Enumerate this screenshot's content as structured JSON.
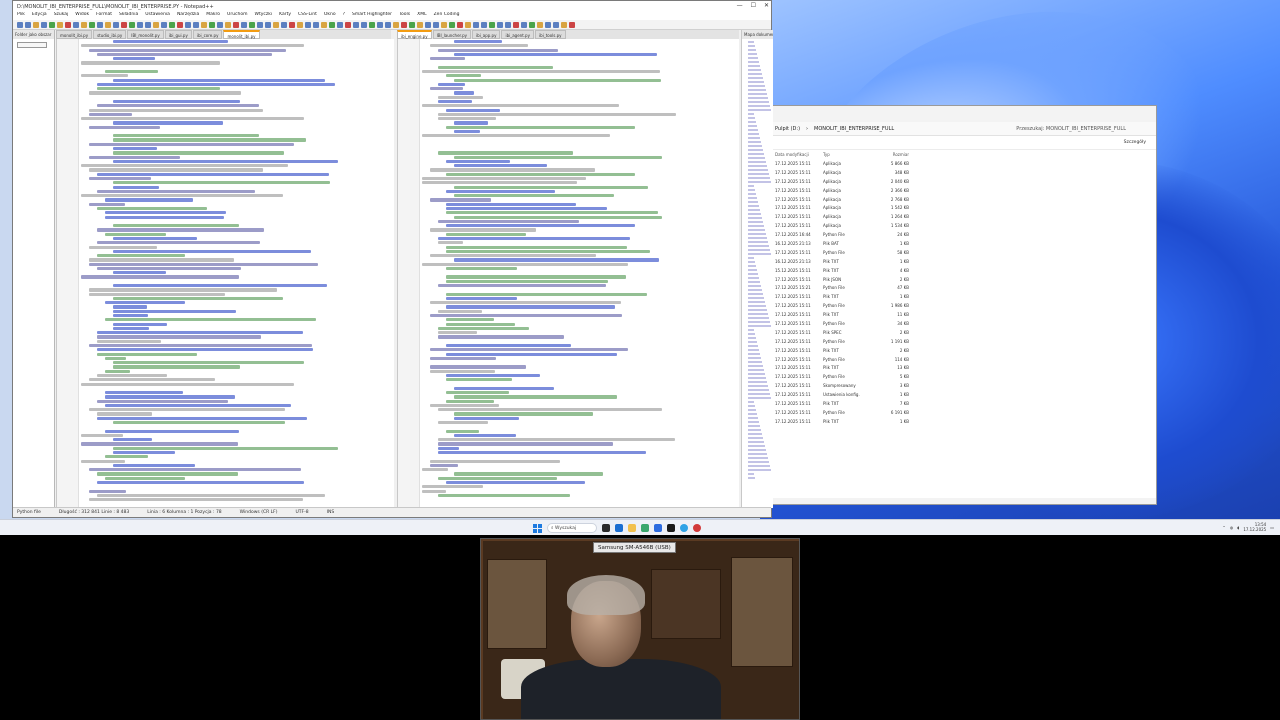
{
  "notepad": {
    "title": "D:\\MONOLIT_IBI_ENTERPRISE_FULL\\MONOLIT_IBI_ENTERPRISE.PY - Notepad++",
    "window_controls": [
      "—",
      "☐",
      "✕"
    ],
    "menu": [
      "Plik",
      "Edycja",
      "Szukaj",
      "Widok",
      "Format",
      "Składnia",
      "Ustawienia",
      "Narzędzia",
      "Makro",
      "Uruchom",
      "Wtyczki",
      "Karty",
      "CSS-Lint",
      "Okno",
      "?",
      "Smart Highlighter",
      "Tools",
      "XML",
      "Zen Coding"
    ],
    "left_tabs": [
      "monolit_ibi.py",
      "studio_ibi.py",
      "IBI_monolit.py",
      "ibi_gui.py",
      "ibi_core.py",
      "monolit_ibi.py"
    ],
    "right_tabs": [
      "ibi_engine.py",
      "IBI_launcher.py",
      "ibi_app.py",
      "ibi_agent.py",
      "ibi_tools.py"
    ],
    "project_panel_title": "Folder jako obszar",
    "docmap_title": "Mapa dokumentu",
    "status": {
      "lang": "Python file",
      "length": "Długość : 312 841   Linie : 8 483",
      "pos": "Linia : 6   Kolumna : 1   Pozycja : 78",
      "eol": "Windows (CR LF)",
      "enc": "UTF-8",
      "mode": "INS"
    }
  },
  "explorer": {
    "breadcrumb": [
      "Pulpit (D:)",
      "MONOLIT_IBI_ENTERPRISE_FULL"
    ],
    "search_placeholder": "Przeszukaj: MONOLIT_IBI_ENTERPRISE_FULL",
    "details_button": "Szczegóły",
    "headers": [
      "Data modyfikacji",
      "Typ",
      "Rozmiar"
    ],
    "rows": [
      [
        "17.12.2025 15:11",
        "Aplikacja",
        "5 866 KB"
      ],
      [
        "17.12.2025 15:11",
        "Aplikacja",
        "348 KB"
      ],
      [
        "17.12.2025 15:11",
        "Aplikacja",
        "2 040 KB"
      ],
      [
        "17.12.2025 15:11",
        "Aplikacja",
        "2 366 KB"
      ],
      [
        "17.12.2025 15:11",
        "Aplikacja",
        "2 768 KB"
      ],
      [
        "17.12.2025 15:11",
        "Aplikacja",
        "1 542 KB"
      ],
      [
        "17.12.2025 15:11",
        "Aplikacja",
        "1 264 KB"
      ],
      [
        "17.12.2025 15:11",
        "Aplikacja",
        "1 534 KB"
      ],
      [
        "17.12.2025 16:44",
        "Python File",
        "24 KB"
      ],
      [
        "16.12.2025 21:13",
        "Plik BAT",
        "1 KB"
      ],
      [
        "17.12.2025 15:11",
        "Python File",
        "58 KB"
      ],
      [
        "16.12.2025 21:13",
        "Plik TXT",
        "1 KB"
      ],
      [
        "15.12.2025 15:11",
        "Plik TXT",
        "4 KB"
      ],
      [
        "17.12.2025 15:11",
        "Plik JSON",
        "2 KB"
      ],
      [
        "17.12.2025 15:21",
        "Python File",
        "47 KB"
      ],
      [
        "17.12.2025 15:11",
        "Plik TXT",
        "1 KB"
      ],
      [
        "17.12.2025 15:11",
        "Python File",
        "1 986 KB"
      ],
      [
        "17.12.2025 15:11",
        "Plik TXT",
        "11 KB"
      ],
      [
        "17.12.2025 15:11",
        "Python File",
        "34 KB"
      ],
      [
        "17.12.2025 15:11",
        "Plik SPEC",
        "2 KB"
      ],
      [
        "17.12.2025 15:11",
        "Python File",
        "1 191 KB"
      ],
      [
        "17.12.2025 15:11",
        "Plik TXT",
        "2 KB"
      ],
      [
        "17.12.2025 15:11",
        "Python File",
        "114 KB"
      ],
      [
        "17.12.2025 15:11",
        "Plik TXT",
        "13 KB"
      ],
      [
        "17.12.2025 15:11",
        "Python File",
        "5 KB"
      ],
      [
        "17.12.2025 15:11",
        "Skompresowany",
        "3 KB"
      ],
      [
        "17.12.2025 15:11",
        "Ustawienia konfig.",
        "1 KB"
      ],
      [
        "17.12.2025 15:11",
        "Plik TXT",
        "7 KB"
      ],
      [
        "17.12.2025 15:11",
        "Python File",
        "6 191 KB"
      ],
      [
        "17.12.2025 15:11",
        "Plik TXT",
        "1 KB"
      ]
    ]
  },
  "taskbar": {
    "search": "Wyszukaj",
    "time": "13:54",
    "date": "17.12.2025"
  },
  "webcam": {
    "title": "Samsung SM-A546B (USB)"
  }
}
